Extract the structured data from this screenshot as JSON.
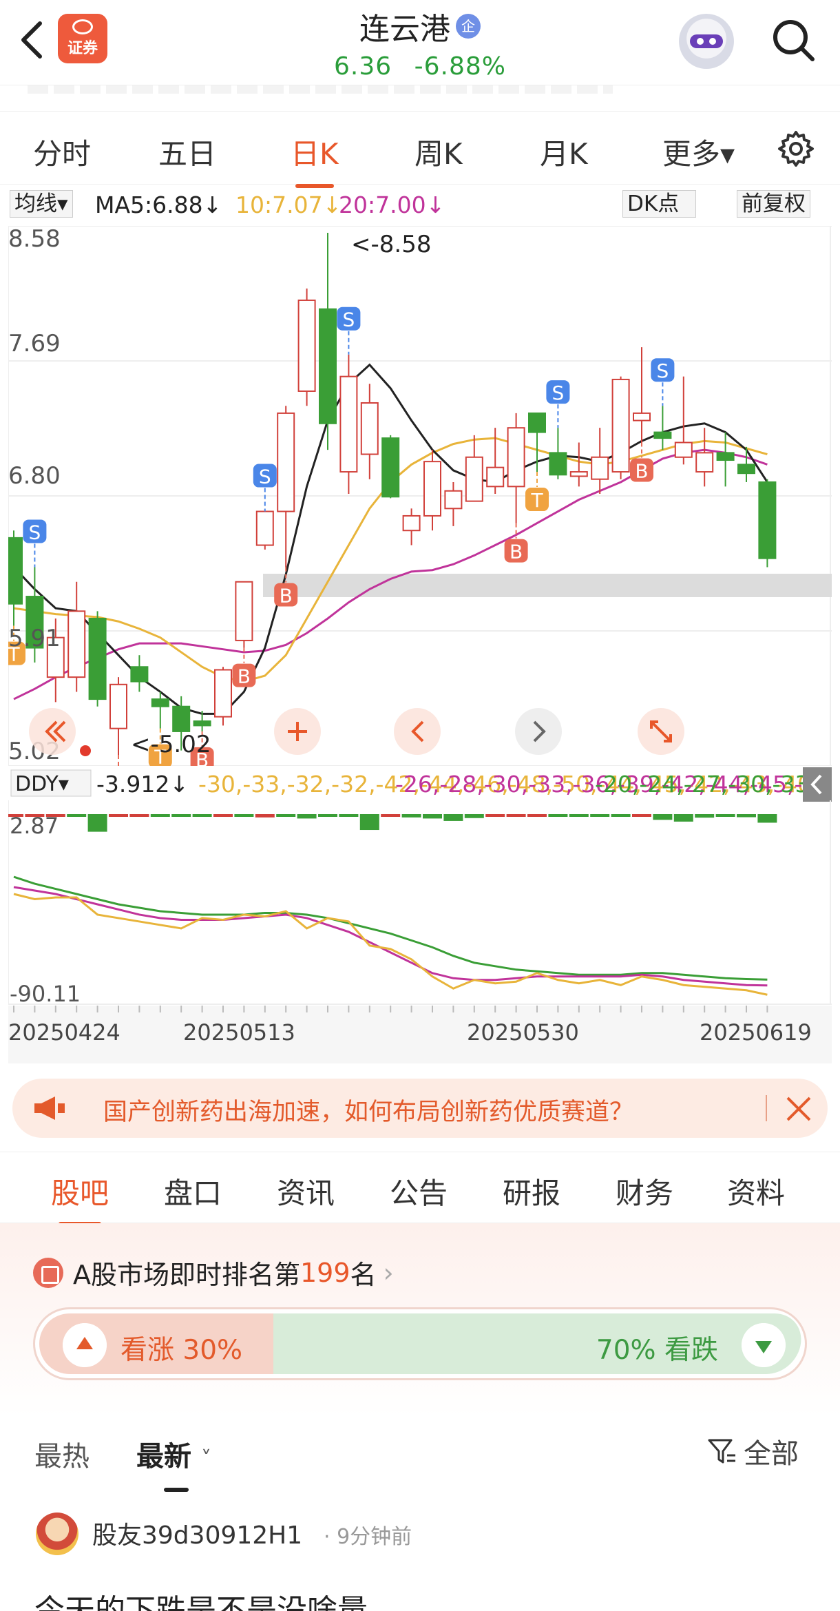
{
  "header": {
    "brand_logo_text": "证券",
    "stock_name": "连云港",
    "stock_badge": "企",
    "price": "6.36",
    "change_pct": "-6.88%"
  },
  "period_tabs": [
    {
      "label": "分时",
      "active": false
    },
    {
      "label": "五日",
      "active": false
    },
    {
      "label": "日K",
      "active": true
    },
    {
      "label": "周K",
      "active": false
    },
    {
      "label": "月K",
      "active": false
    },
    {
      "label": "更多▾",
      "active": false
    }
  ],
  "ma_row": {
    "selector": "均线▾",
    "ma5": "MA5:6.88↓",
    "ma10": "10:7.07↓",
    "ma20": "20:7.00↓",
    "dk_points": "DK点",
    "adjust": "前复权",
    "colors": {
      "ma5": "#222222",
      "ma10": "#e8b43a",
      "ma20": "#c0339a"
    }
  },
  "chart_data": {
    "type": "candlestick",
    "y_axis_labels": [
      "8.58",
      "7.69",
      "6.80",
      "5.91",
      "5.02"
    ],
    "ylim": [
      5.02,
      8.58
    ],
    "x_tick_labels": [
      "20250424",
      "20250513",
      "20250530",
      "20250619"
    ],
    "high_marker": "<-8.58",
    "low_marker": "<-5.02",
    "colors": {
      "up": "#d1403a",
      "down": "#3a9e36"
    },
    "candles": [
      {
        "o": 6.5,
        "h": 6.55,
        "l": 5.9,
        "c": 6.05
      },
      {
        "o": 6.1,
        "h": 6.3,
        "l": 5.65,
        "c": 5.75
      },
      {
        "o": 5.55,
        "h": 5.95,
        "l": 5.38,
        "c": 5.82
      },
      {
        "o": 5.55,
        "h": 6.2,
        "l": 5.45,
        "c": 6.0
      },
      {
        "o": 5.95,
        "h": 6.0,
        "l": 5.35,
        "c": 5.4
      },
      {
        "o": 5.2,
        "h": 5.55,
        "l": 5.02,
        "c": 5.5
      },
      {
        "o": 5.62,
        "h": 5.7,
        "l": 5.45,
        "c": 5.52
      },
      {
        "o": 5.4,
        "h": 5.45,
        "l": 5.2,
        "c": 5.35
      },
      {
        "o": 5.35,
        "h": 5.42,
        "l": 5.05,
        "c": 5.18
      },
      {
        "o": 5.25,
        "h": 5.32,
        "l": 5.18,
        "c": 5.22
      },
      {
        "o": 5.28,
        "h": 5.62,
        "l": 5.22,
        "c": 5.6
      },
      {
        "o": 5.8,
        "h": 6.2,
        "l": 5.75,
        "c": 6.2
      },
      {
        "o": 6.45,
        "h": 6.68,
        "l": 6.42,
        "c": 6.68
      },
      {
        "o": 6.68,
        "h": 7.4,
        "l": 6.3,
        "c": 7.35
      },
      {
        "o": 7.5,
        "h": 8.2,
        "l": 7.4,
        "c": 8.12
      },
      {
        "o": 8.06,
        "h": 8.58,
        "l": 7.1,
        "c": 7.28
      },
      {
        "o": 6.95,
        "h": 7.75,
        "l": 6.8,
        "c": 7.6
      },
      {
        "o": 7.07,
        "h": 7.55,
        "l": 6.9,
        "c": 7.42
      },
      {
        "o": 7.18,
        "h": 7.2,
        "l": 6.77,
        "c": 6.78
      },
      {
        "o": 6.55,
        "h": 6.7,
        "l": 6.45,
        "c": 6.65
      },
      {
        "o": 6.65,
        "h": 7.1,
        "l": 6.55,
        "c": 7.02
      },
      {
        "o": 6.7,
        "h": 6.88,
        "l": 6.58,
        "c": 6.82
      },
      {
        "o": 6.75,
        "h": 7.2,
        "l": 6.75,
        "c": 7.05
      },
      {
        "o": 6.85,
        "h": 7.25,
        "l": 6.8,
        "c": 6.98
      },
      {
        "o": 6.85,
        "h": 7.35,
        "l": 6.6,
        "c": 7.25
      },
      {
        "o": 7.35,
        "h": 7.35,
        "l": 6.95,
        "c": 7.22
      },
      {
        "o": 7.08,
        "h": 7.25,
        "l": 6.9,
        "c": 6.93
      },
      {
        "o": 6.92,
        "h": 7.15,
        "l": 6.85,
        "c": 6.95
      },
      {
        "o": 6.9,
        "h": 7.25,
        "l": 6.8,
        "c": 7.05
      },
      {
        "o": 6.95,
        "h": 7.6,
        "l": 6.9,
        "c": 7.58
      },
      {
        "o": 7.3,
        "h": 7.8,
        "l": 7.15,
        "c": 7.35
      },
      {
        "o": 7.22,
        "h": 7.4,
        "l": 7.1,
        "c": 7.18
      },
      {
        "o": 7.05,
        "h": 7.6,
        "l": 7.0,
        "c": 7.15
      },
      {
        "o": 6.95,
        "h": 7.25,
        "l": 6.85,
        "c": 7.08
      },
      {
        "o": 7.08,
        "h": 7.22,
        "l": 6.85,
        "c": 7.03
      },
      {
        "o": 7.0,
        "h": 7.12,
        "l": 6.88,
        "c": 6.94
      },
      {
        "o": 6.88,
        "h": 6.9,
        "l": 6.3,
        "c": 6.36
      }
    ],
    "ma5": [
      6.3,
      6.15,
      6.02,
      6.0,
      5.85,
      5.7,
      5.55,
      5.45,
      5.34,
      5.3,
      5.3,
      5.45,
      5.75,
      6.25,
      6.85,
      7.3,
      7.55,
      7.68,
      7.52,
      7.3,
      7.1,
      6.96,
      6.9,
      6.88,
      6.96,
      7.02,
      7.06,
      7.05,
      7.02,
      7.08,
      7.16,
      7.22,
      7.26,
      7.28,
      7.22,
      7.1,
      6.88
    ],
    "ma10": [
      6.02,
      6.0,
      5.98,
      5.97,
      5.96,
      5.93,
      5.88,
      5.82,
      5.72,
      5.62,
      5.55,
      5.52,
      5.56,
      5.7,
      5.95,
      6.2,
      6.45,
      6.7,
      6.88,
      7.0,
      7.08,
      7.14,
      7.17,
      7.18,
      7.14,
      7.1,
      7.06,
      7.02,
      7.0,
      7.02,
      7.06,
      7.1,
      7.14,
      7.16,
      7.15,
      7.11,
      7.07
    ],
    "ma20": [
      5.4,
      5.47,
      5.55,
      5.62,
      5.68,
      5.74,
      5.78,
      5.78,
      5.78,
      5.76,
      5.74,
      5.72,
      5.73,
      5.77,
      5.85,
      5.95,
      6.06,
      6.15,
      6.22,
      6.27,
      6.28,
      6.32,
      6.38,
      6.45,
      6.52,
      6.6,
      6.68,
      6.76,
      6.82,
      6.88,
      6.96,
      7.04,
      7.08,
      7.1,
      7.08,
      7.05,
      7.0
    ],
    "signals": [
      {
        "i": 0,
        "label": "T",
        "side": "buy"
      },
      {
        "i": 1,
        "label": "S",
        "side": "sell"
      },
      {
        "i": 5,
        "label": "B",
        "side": "buy"
      },
      {
        "i": 7,
        "label": "T",
        "side": "buy"
      },
      {
        "i": 9,
        "label": "B",
        "side": "buy"
      },
      {
        "i": 11,
        "label": "B",
        "side": "buy"
      },
      {
        "i": 12,
        "label": "S",
        "side": "sell"
      },
      {
        "i": 13,
        "label": "B",
        "side": "buy"
      },
      {
        "i": 16,
        "label": "S",
        "side": "sell"
      },
      {
        "i": 24,
        "label": "B",
        "side": "buy"
      },
      {
        "i": 25,
        "label": "T",
        "side": "buy"
      },
      {
        "i": 26,
        "label": "S",
        "side": "sell"
      },
      {
        "i": 30,
        "label": "B",
        "side": "buy"
      },
      {
        "i": 31,
        "label": "S",
        "side": "sell"
      }
    ],
    "ddy": {
      "selector": "DDY▾",
      "ddy_value": "-3.912↓",
      "ddy1": [
        -30,
        -33,
        -32,
        -32,
        -42,
        -44,
        -46,
        -48,
        -50,
        -44,
        -45,
        -42,
        -43,
        -40,
        -50,
        -44,
        -46,
        -60,
        -62,
        -68,
        -78,
        -85,
        -80,
        -82,
        -81,
        -76,
        -80,
        -82,
        -80,
        -83,
        -78,
        -80,
        -83,
        -84,
        -85,
        -86,
        -88.6
      ],
      "ddy2": [
        -26,
        -28,
        -30,
        -33,
        -36,
        -39,
        -42,
        -44,
        -45,
        -45,
        -45,
        -44,
        -43,
        -42,
        -44,
        -48,
        -52,
        -58,
        -64,
        -70,
        -76,
        -79,
        -80,
        -80,
        -79,
        -78,
        -78,
        -78,
        -78,
        -78,
        -77,
        -78,
        -80,
        -81,
        -82,
        -83,
        -83.2
      ],
      "ddy3": [
        -20,
        -24,
        -27,
        -30,
        -33,
        -36,
        -38,
        -40,
        -41,
        -42,
        -42,
        -42,
        -41,
        -41,
        -42,
        -44,
        -47,
        -50,
        -53,
        -57,
        -61,
        -66,
        -70,
        -72,
        -74,
        -75,
        -76,
        -77,
        -77,
        -77,
        -76,
        -76,
        -77,
        -78,
        -79,
        -79.5,
        -79.8
      ],
      "y_labels": [
        "2.87",
        "-90.11"
      ],
      "ylim": [
        -90.11,
        2.87
      ],
      "colors": {
        "ddy1": "#e8b43a",
        "ddy2": "#c0339a",
        "ddy3": "#3a9e36"
      },
      "bars": [
        0.2,
        0.3,
        0.1,
        -1.2,
        -8.0,
        0.5,
        0.2,
        -0.8,
        -0.5,
        -0.6,
        0.3,
        -0.9,
        1.5,
        -0.3,
        -2.0,
        -0.8,
        -1.0,
        -7.2,
        0.2,
        -1.5,
        -2.0,
        -3.1,
        -1.8,
        0.3,
        0.4,
        0.2,
        -0.6,
        -1.2,
        -0.8,
        -1.0,
        0.6,
        -2.6,
        -3.4,
        -1.6,
        -1.0,
        -1.4,
        -3.9
      ]
    }
  },
  "chart_controls": {
    "prev_label": "‹",
    "next_label": "›"
  },
  "promo": {
    "text": "国产创新药出海加速，如何布局创新药优质赛道？"
  },
  "bottom_tabs": [
    {
      "label": "股吧",
      "active": true
    },
    {
      "label": "盘口",
      "active": false
    },
    {
      "label": "资讯",
      "active": false
    },
    {
      "label": "公告",
      "active": false
    },
    {
      "label": "研报",
      "active": false
    },
    {
      "label": "财务",
      "active": false
    },
    {
      "label": "资料",
      "active": false
    }
  ],
  "ranking": {
    "prefix": "A股市场即时排名第",
    "rank": "199",
    "suffix": "名",
    "arrow": "›"
  },
  "sentiment": {
    "up_label": "看涨 30%",
    "down_label": "70% 看跌",
    "up_pct": 30,
    "down_pct": 70
  },
  "feed_sort": {
    "hot": "最热",
    "latest": "最新",
    "filter": "全部"
  },
  "post": {
    "user": "股友39d30912H1",
    "time": "· 9分钟前",
    "text": "今天的下跌是不是没啥量"
  }
}
